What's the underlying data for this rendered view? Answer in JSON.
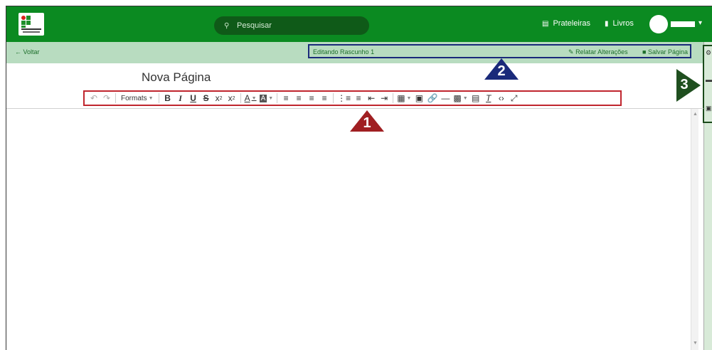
{
  "header": {
    "search_placeholder": "Pesquisar",
    "shelves_label": "Prateleiras",
    "books_label": "Livros",
    "user_caret": "▾"
  },
  "subbar": {
    "back_label": "Voltar",
    "editing_label": "Editando Rascunho",
    "draft_number": "1",
    "report_changes_label": "Relatar Alterações",
    "save_page_label": "Salvar Página"
  },
  "editor": {
    "page_title": "Nova Página",
    "formats_label": "Formats"
  },
  "toolbar_icons": [
    "undo-icon",
    "redo-icon",
    "formats-dropdown",
    "bold-icon",
    "italic-icon",
    "underline-icon",
    "strikethrough-icon",
    "superscript-icon",
    "subscript-icon",
    "text-color-icon",
    "background-color-icon",
    "align-left-icon",
    "align-center-icon",
    "align-right-icon",
    "align-justify-icon",
    "bullet-list-icon",
    "numbered-list-icon",
    "outdent-icon",
    "indent-icon",
    "table-icon",
    "image-icon",
    "link-icon",
    "horizontal-rule-icon",
    "media-icon",
    "code-sample-icon",
    "clear-formatting-icon",
    "source-code-icon",
    "fullscreen-icon"
  ],
  "callouts": {
    "one": "1",
    "two": "2",
    "three": "3"
  },
  "colors": {
    "header_green": "#0b8a21",
    "subbar_green": "#b8dcc0",
    "callout_red": "#a01f22",
    "callout_blue": "#1a2a7a",
    "callout_green": "#1f4f1f"
  }
}
